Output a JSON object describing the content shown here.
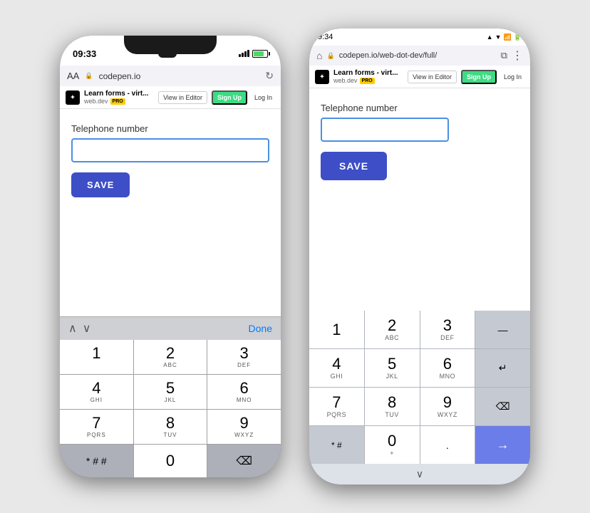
{
  "background": "#e8e8e8",
  "phone_left": {
    "status_bar": {
      "time": "09:33",
      "battery_pct": 70
    },
    "url_bar": {
      "aa_label": "AA",
      "lock_symbol": "🔒",
      "url": "codepen.io",
      "reload_symbol": "↻"
    },
    "toolbar": {
      "logo_symbol": "✦",
      "title": "Learn forms - virt...",
      "domain": "web.dev",
      "pro_label": "PRO",
      "view_editor_label": "View in Editor",
      "signup_label": "Sign Up",
      "login_label": "Log In"
    },
    "form": {
      "label": "Telephone number",
      "input_value": "",
      "save_label": "SAVE"
    },
    "keyboard": {
      "done_label": "Done",
      "keys": [
        {
          "main": "1",
          "sub": ""
        },
        {
          "main": "2",
          "sub": "ABC"
        },
        {
          "main": "3",
          "sub": "DEF"
        },
        {
          "main": "4",
          "sub": "GHI"
        },
        {
          "main": "5",
          "sub": "JKL"
        },
        {
          "main": "6",
          "sub": "MNO"
        },
        {
          "main": "7",
          "sub": "PQRS"
        },
        {
          "main": "8",
          "sub": "TUV"
        },
        {
          "main": "9",
          "sub": "WXYZ"
        },
        {
          "main": "* # #",
          "sub": ""
        },
        {
          "main": "0",
          "sub": ""
        },
        {
          "main": "⌫",
          "sub": ""
        }
      ]
    }
  },
  "phone_right": {
    "status_bar": {
      "time": "9:34",
      "icons": "🔋📶"
    },
    "url_bar": {
      "home_icon": "⌂",
      "lock_symbol": "🔒",
      "url": "codepen.io/web-dot-dev/full/",
      "tabs_icon": "⧉",
      "menu_icon": "⋮"
    },
    "toolbar": {
      "logo_symbol": "✦",
      "title": "Learn forms - virt...",
      "domain": "web.dev",
      "pro_label": "PRO",
      "view_editor_label": "View in Editor",
      "signup_label": "Sign Up",
      "login_label": "Log In"
    },
    "form": {
      "label": "Telephone number",
      "input_value": "",
      "save_label": "SAVE"
    },
    "keyboard": {
      "keys": [
        {
          "main": "1",
          "sub": "",
          "type": "normal"
        },
        {
          "main": "2",
          "sub": "ABC",
          "type": "normal"
        },
        {
          "main": "3",
          "sub": "DEF",
          "type": "normal"
        },
        {
          "main": "—",
          "sub": "",
          "type": "dark"
        },
        {
          "main": "4",
          "sub": "GHI",
          "type": "normal"
        },
        {
          "main": "5",
          "sub": "JKL",
          "type": "normal"
        },
        {
          "main": "6",
          "sub": "MNO",
          "type": "normal"
        },
        {
          "main": "↵",
          "sub": "",
          "type": "dark"
        },
        {
          "main": "7",
          "sub": "PQRS",
          "type": "normal"
        },
        {
          "main": "8",
          "sub": "TUV",
          "type": "normal"
        },
        {
          "main": "9",
          "sub": "WXYZ",
          "type": "normal"
        },
        {
          "main": "⌫",
          "sub": "",
          "type": "dark"
        },
        {
          "main": "* #",
          "sub": "",
          "type": "dark"
        },
        {
          "main": "0",
          "sub": "+",
          "type": "normal"
        },
        {
          "main": ".",
          "sub": "",
          "type": "normal"
        },
        {
          "main": "→",
          "sub": "",
          "type": "blue"
        }
      ]
    }
  }
}
